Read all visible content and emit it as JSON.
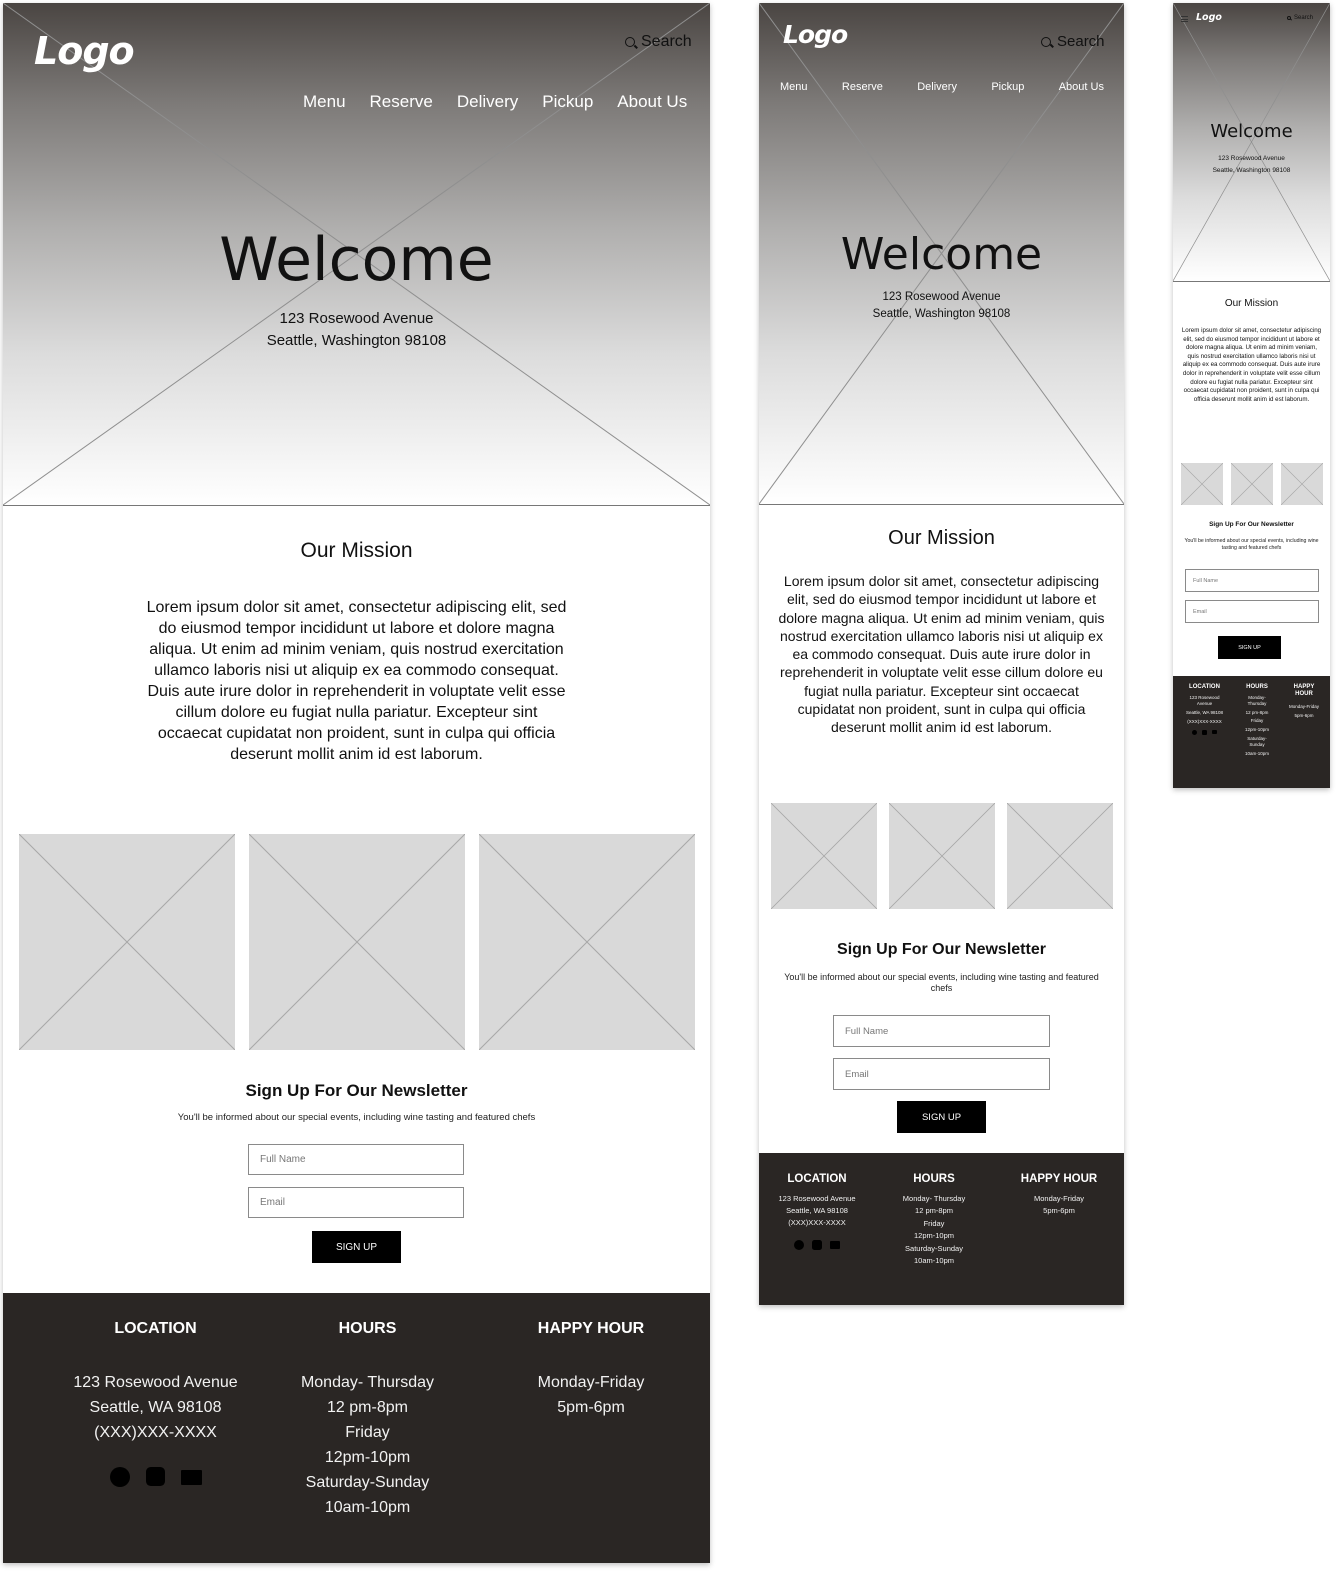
{
  "site": {
    "logo": "Logo",
    "search_label": "Search",
    "nav": [
      "Menu",
      "Reserve",
      "Delivery",
      "Pickup",
      "About Us"
    ],
    "hero": {
      "title": "Welcome",
      "address_line1": "123 Rosewood Avenue",
      "address_line2": "Seattle, Washington 98108"
    },
    "mission": {
      "title": "Our Mission",
      "body": "Lorem ipsum dolor sit amet, consectetur adipiscing elit, sed do eiusmod tempor incididunt ut labore et dolore magna aliqua. Ut enim ad minim veniam, quis nostrud exercitation ullamco laboris nisi ut aliquip ex ea commodo consequat. Duis aute irure dolor in reprehenderit in voluptate velit esse cillum dolore eu fugiat nulla pariatur. Excepteur sint occaecat cupidatat non proident, sunt in culpa qui officia deserunt mollit anim id est laborum."
    },
    "gallery_count": 3,
    "newsletter": {
      "title": "Sign Up For Our Newsletter",
      "subtitle": "You'll be informed about our special events, including wine tasting and featured chefs",
      "full_name_placeholder": "Full Name",
      "email_placeholder": "Email",
      "button": "SIGN UP"
    },
    "footer": {
      "location": {
        "heading": "LOCATION",
        "lines": [
          "123 Rosewood Avenue",
          "Seattle, WA 98108",
          "(XXX)XXX-XXXX"
        ],
        "social_icons": [
          "facebook-icon",
          "instagram-icon",
          "mail-icon"
        ]
      },
      "hours": {
        "heading": "HOURS",
        "lines": [
          "Monday- Thursday",
          "12 pm-8pm",
          "Friday",
          "12pm-10pm",
          "Saturday-Sunday",
          "10am-10pm"
        ]
      },
      "happy_hour": {
        "heading": "HAPPY HOUR",
        "lines": [
          "Monday-Friday",
          "5pm-6pm"
        ]
      }
    }
  },
  "colors": {
    "footer_bg": "#2a2624",
    "placeholder_gray": "#d9d9d9",
    "button_bg": "#000000"
  }
}
